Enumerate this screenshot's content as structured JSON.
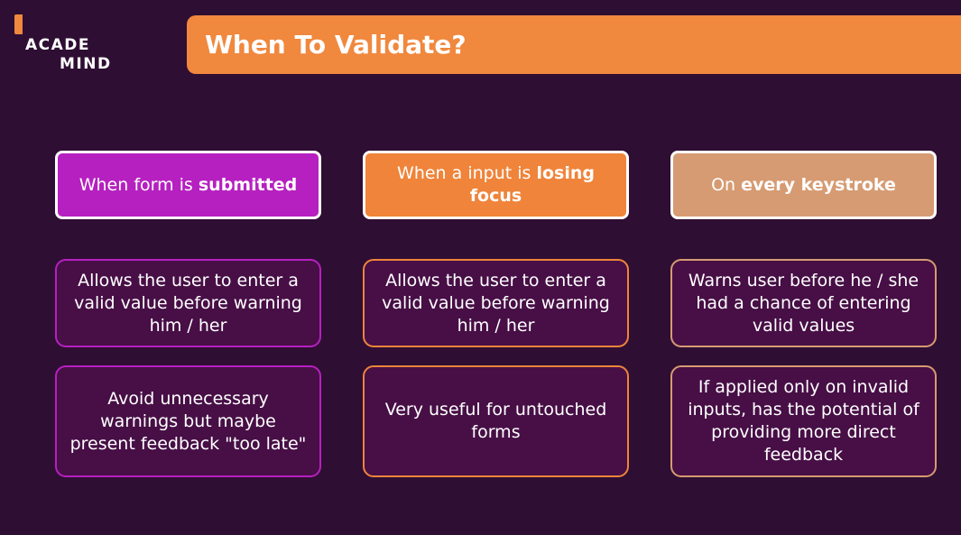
{
  "logo": {
    "line1": "ACADE",
    "line2": "MIND"
  },
  "title": "When To Validate?",
  "columns": [
    {
      "head_pre": "When form is ",
      "head_bold": "submitted",
      "row1": "Allows the user to enter a valid value before warning him / her",
      "row2": "Avoid unnecessary warnings but maybe present feedback \"too late\""
    },
    {
      "head_pre": "When a input is ",
      "head_bold": "losing focus",
      "row1": "Allows the user to enter a valid value before warning him / her",
      "row2": "Very useful for untouched forms"
    },
    {
      "head_pre": "On ",
      "head_bold": "every keystroke",
      "row1": "Warns user before he / she had a chance of entering valid values",
      "row2": "If applied only on invalid inputs, has the potential of providing more direct feedback"
    }
  ],
  "colors": {
    "background": "#2f0e33",
    "accent_orange": "#f0883e",
    "accent_magenta": "#b620c0",
    "accent_tan": "#d69b72"
  }
}
